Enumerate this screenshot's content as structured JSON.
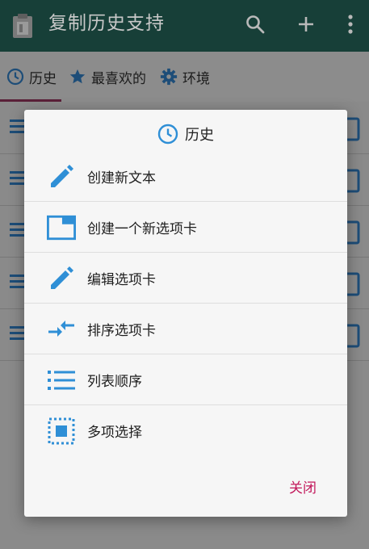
{
  "app": {
    "title": "复制历史支持"
  },
  "tabs": [
    {
      "label": "历史",
      "icon": "clock-icon"
    },
    {
      "label": "最喜欢的",
      "icon": "star-icon"
    },
    {
      "label": "环境",
      "icon": "gear-icon"
    }
  ],
  "dialog": {
    "title": "历史",
    "items": [
      {
        "label": "创建新文本",
        "icon": "pencil-icon"
      },
      {
        "label": "创建一个新选项卡",
        "icon": "new-tab-icon"
      },
      {
        "label": "编辑选项卡",
        "icon": "pencil-icon"
      },
      {
        "label": "排序选项卡",
        "icon": "sort-arrows-icon"
      },
      {
        "label": "列表顺序",
        "icon": "list-icon"
      },
      {
        "label": "多项选择",
        "icon": "multi-select-icon"
      }
    ],
    "close_label": "关闭"
  },
  "colors": {
    "appbar": "#173f38",
    "accent_blue": "#2f8fd6",
    "close_text": "#c2185b",
    "tab_indicator": "#5a2038"
  }
}
